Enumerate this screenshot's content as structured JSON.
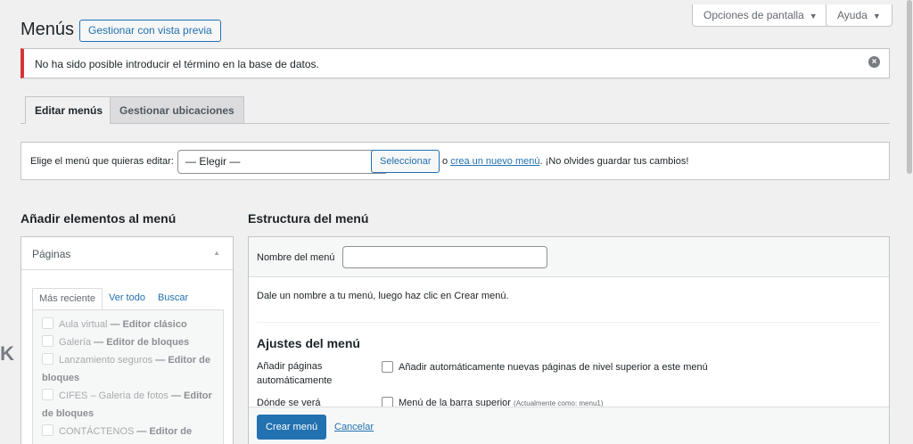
{
  "header": {
    "title": "Menús",
    "preview_button": "Gestionar con vista previa",
    "screen_options": "Opciones de pantalla",
    "help": "Ayuda",
    "caret": "▼"
  },
  "notice": {
    "message": "No ha sido posible introducir el término en la base de datos.",
    "dismiss_icon": "×"
  },
  "tabs": {
    "edit": "Editar menús",
    "locations": "Gestionar ubicaciones"
  },
  "select_menu": {
    "label": "Elige el menú que quieras editar:",
    "dropdown_value": "— Elegir —",
    "chevron": "⌄",
    "select_button": "Seleccionar",
    "or": "o",
    "create_link": "crea un nuevo menú",
    "reminder": ". ¡No olvides guardar tus cambios!"
  },
  "left": {
    "heading": "Añadir elementos al menú",
    "panel_title": "Páginas",
    "arrow": "▲",
    "subtabs": [
      "Más reciente",
      "Ver todo",
      "Buscar"
    ],
    "pages": [
      {
        "title": "Aula virtual",
        "sep": " — ",
        "state": "Editor clásico"
      },
      {
        "title": "Galería",
        "sep": " — ",
        "state": "Editor de bloques"
      },
      {
        "title": "Lanzamiento seguros",
        "sep": " — ",
        "state": "Editor de bloques"
      },
      {
        "title": "CIFES – Galería de fotos",
        "sep": " — ",
        "state": "Editor de bloques"
      },
      {
        "title": "CONTÁCTENOS",
        "sep": " — ",
        "state": "Editor de"
      }
    ]
  },
  "right": {
    "heading": "Estructura del menú",
    "name_label": "Nombre del menú",
    "name_value": "",
    "description": "Dale un nombre a tu menú, luego haz clic en Crear menú.",
    "settings_title": "Ajustes del menú",
    "auto_add_label_1": "Añadir páginas",
    "auto_add_label_2": "automáticamente",
    "auto_add_option": "Añadir automáticamente nuevas páginas de nivel superior a este menú",
    "location_label": "Dónde se verá",
    "location_option": "Menú de la barra superior",
    "location_note": "(Actualmente como: menu1)",
    "create_button": "Crear menú",
    "cancel_link": "Cancelar"
  },
  "edge_glyph": "K"
}
